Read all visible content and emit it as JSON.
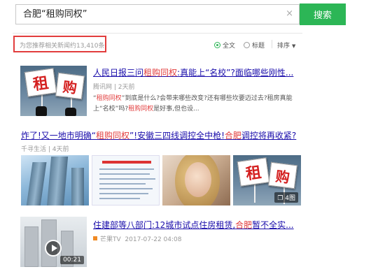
{
  "search": {
    "query": "合肥“租购同权”",
    "clear_icon": "×",
    "button_label": "搜索"
  },
  "results_summary": {
    "count_text": "为您推荐相关新闻约13,410条"
  },
  "filters": {
    "full_text": "全文",
    "title": "标题",
    "sort": "排序"
  },
  "results": [
    {
      "title_parts": [
        "人民日报三问",
        "租购同权",
        ":真能上“名校”?面临哪些刚性..."
      ],
      "source": "腾讯网",
      "time": "2天前",
      "snippet_parts": [
        "“",
        "租购同权",
        "”到底是什么?会带来哪些改变?还有哪些坎要迈过去?租房真能上“名校”吗?",
        "租购同权",
        "是好事,但也设..."
      ],
      "thumb_sign1": "租",
      "thumb_sign2": "购"
    },
    {
      "title_parts": [
        "炸了!又一地市明确“",
        "租购同权",
        "”!安徽三四线调控全中枪!",
        "合肥",
        "调控将再收紧?"
      ],
      "source": "千寻生活",
      "time": "4天前",
      "image_badge": "4图",
      "thumb_sign1": "租",
      "thumb_sign2": "购"
    },
    {
      "title_parts": [
        "住建部等八部门:12城市试点住房租赁,",
        "合肥",
        "暂不全实..."
      ],
      "source": "芒果TV",
      "time": "2017-07-22 04:08",
      "video_duration": "00:21"
    }
  ]
}
